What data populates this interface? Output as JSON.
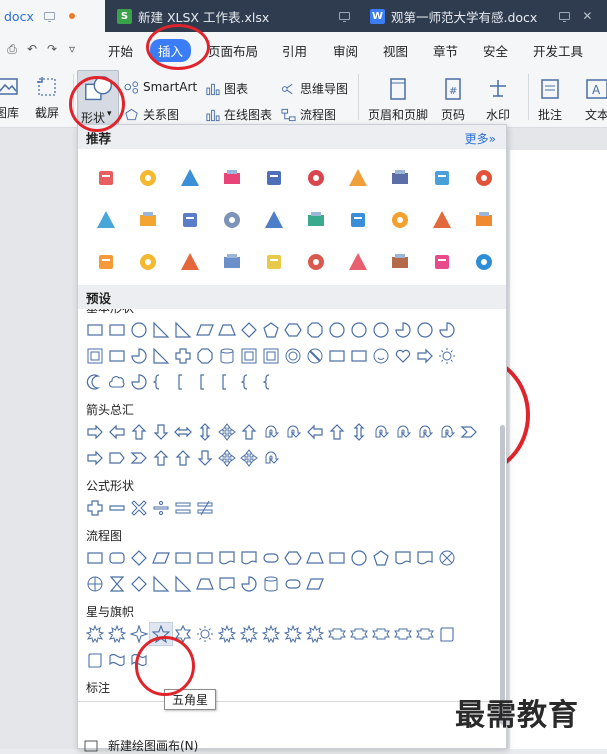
{
  "tabs": [
    {
      "label": "docx"
    },
    {
      "label": "新建 XLSX 工作表.xlsx",
      "icon_letter": "S",
      "icon_color": "#3aa34a"
    },
    {
      "label": "观第一师范大学有感.docx",
      "icon_letter": "W",
      "icon_color": "#3b7df6"
    }
  ],
  "menu": {
    "items": [
      "开始",
      "插入",
      "页面布局",
      "引用",
      "审阅",
      "视图",
      "章节",
      "安全",
      "开发工具"
    ],
    "active": "插入"
  },
  "ribbon": {
    "library": "图库",
    "screenshot": "截屏",
    "shapes": "形状",
    "smartart": "SmartArt",
    "chart": "图表",
    "mindmap": "思维导图",
    "relation": "关系图",
    "online_chart": "在线图表",
    "flowchart": "流程图",
    "header_footer": "页眉和页脚",
    "page_number": "页码",
    "watermark": "水印",
    "comment": "批注",
    "text": "文本"
  },
  "panel": {
    "recommend_title": "推荐",
    "more_label": "更多»",
    "preset_title": "预设",
    "basic_title": "基本形状",
    "categories": {
      "arrows": "箭头总汇",
      "formula": "公式形状",
      "flowchart": "流程图",
      "stars": "星与旗帜",
      "callouts": "标注"
    },
    "tooltip": "五角星",
    "new_canvas": "新建绘图画布(N)"
  },
  "watermark_text": "最需教育",
  "colors": {
    "accent": "#3b7df6",
    "shape_stroke": "#4a6fa5",
    "annotation": "#e0242c"
  }
}
